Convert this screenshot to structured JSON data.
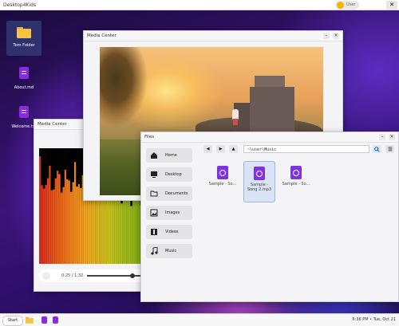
{
  "topbar": {
    "title": "Desktop4Kids",
    "user": "User",
    "close": "✕"
  },
  "desktop_icons": [
    {
      "label": "Tom Folder",
      "type": "folder"
    },
    {
      "label": "About.md",
      "type": "file"
    },
    {
      "label": "Welcome.txt",
      "type": "file"
    }
  ],
  "media_back": {
    "title": "Media Center",
    "time": "0:25 / 1:32"
  },
  "media_front": {
    "title": "Media Center"
  },
  "files": {
    "title": "Files",
    "path": "~\\user\\Music",
    "sidebar": [
      "Home",
      "Desktop",
      "Documents",
      "Images",
      "Videos",
      "Music"
    ],
    "items": [
      {
        "name": "Sample - So...",
        "selected": false
      },
      {
        "name": "Sample - Song 2.mp3",
        "selected": true
      },
      {
        "name": "Sample - So...",
        "selected": false
      }
    ]
  },
  "window_buttons": {
    "minimize": "–",
    "close": "×"
  },
  "taskbar": {
    "start": "Start",
    "clock": "6:36 PM • Tue, Oct 21"
  },
  "colors": {
    "accent": "#7d33e0",
    "folder": "#f7c243",
    "selection": "#d8e4f6"
  }
}
